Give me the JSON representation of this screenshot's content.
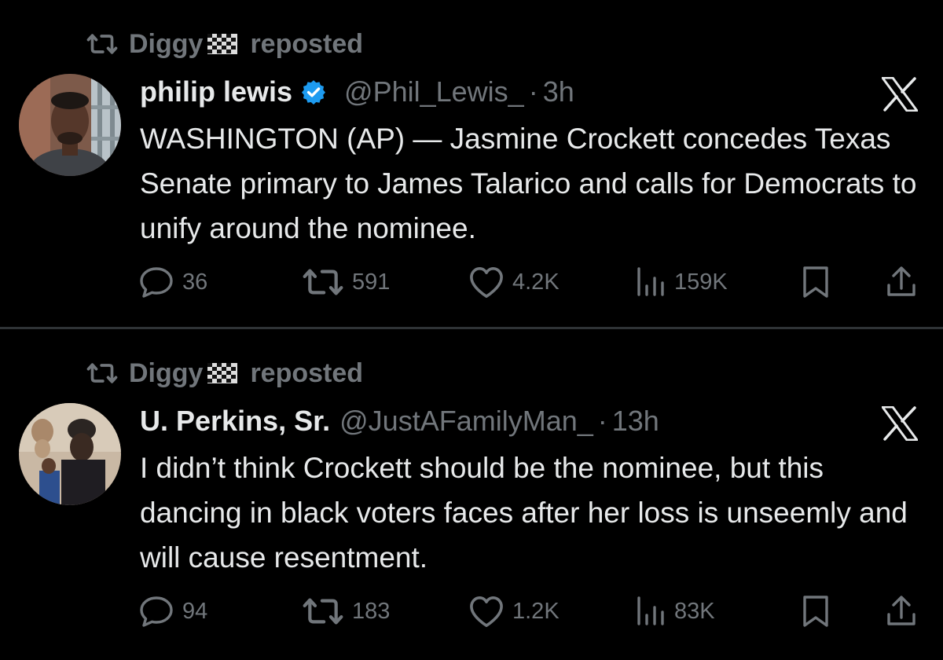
{
  "tweets": [
    {
      "reposter": "Diggy",
      "repost_text": "reposted",
      "name": "philip lewis",
      "verified": true,
      "handle": "@Phil_Lewis_",
      "time": "3h",
      "text": "WASHINGTON (AP) — Jasmine Crockett concedes Texas Senate primary to James Talarico and calls for Democrats to unify around the nominee.",
      "replies": "36",
      "reposts": "591",
      "likes": "4.2K",
      "views": "159K"
    },
    {
      "reposter": "Diggy",
      "repost_text": "reposted",
      "name": "U. Perkins, Sr.",
      "verified": false,
      "handle": "@JustAFamilyMan_",
      "time": "13h",
      "text": "I didn’t think Crockett should be the nominee, but this dancing in black voters faces after her loss is unseemly and will cause resentment.",
      "replies": "94",
      "reposts": "183",
      "likes": "1.2K",
      "views": "83K"
    }
  ],
  "icons": {
    "repost": "repost-icon",
    "flag": "checkered-flag-icon",
    "verified": "verified-badge-icon",
    "platform": "x-logo-icon",
    "reply": "reply-icon",
    "like": "heart-icon",
    "views": "views-icon",
    "bookmark": "bookmark-icon",
    "share": "share-icon"
  },
  "colors": {
    "background": "#000000",
    "text": "#e7e9ea",
    "muted": "#71767b",
    "verified": "#1d9bf0",
    "divider": "#2f3336"
  }
}
